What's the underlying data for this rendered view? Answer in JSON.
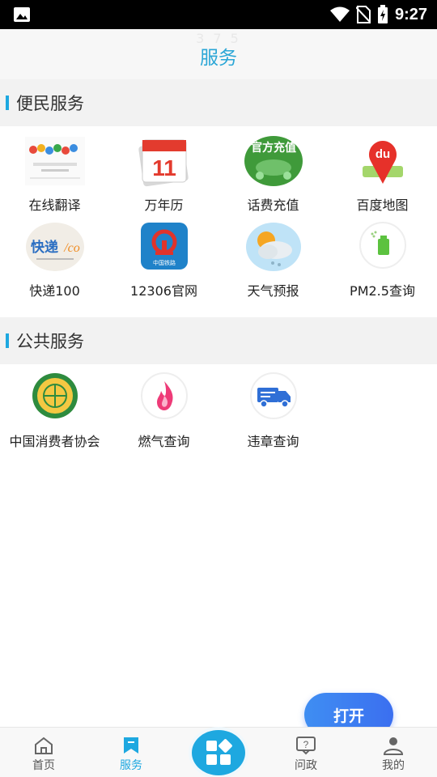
{
  "status_bar": {
    "time": "9:27"
  },
  "header": {
    "ghost_text": "3 7 5",
    "title": "服务"
  },
  "sections": {
    "bianmin": {
      "title": "便民服务",
      "items": [
        {
          "label": "在线翻译",
          "icon": "translate-icon"
        },
        {
          "label": "万年历",
          "icon": "calendar-icon",
          "icon_text": "11"
        },
        {
          "label": "话费充值",
          "icon": "phone-recharge-icon",
          "icon_text": "官方充值"
        },
        {
          "label": "百度地图",
          "icon": "map-pin-icon",
          "icon_text": "du"
        },
        {
          "label": "快递100",
          "icon": "express-icon",
          "icon_text": "快递"
        },
        {
          "label": "12306官网",
          "icon": "railway-icon",
          "icon_text": "中国铁路"
        },
        {
          "label": "天气预报",
          "icon": "weather-icon"
        },
        {
          "label": "PM2.5查询",
          "icon": "air-quality-icon"
        }
      ]
    },
    "gonggong": {
      "title": "公共服务",
      "items": [
        {
          "label": "中国消费者协会",
          "icon": "consumer-association-icon"
        },
        {
          "label": "燃气查询",
          "icon": "flame-icon"
        },
        {
          "label": "违章查询",
          "icon": "truck-icon"
        }
      ]
    }
  },
  "floating": {
    "open_label": "打开"
  },
  "tabbar": [
    {
      "label": "首页",
      "icon": "home-icon"
    },
    {
      "label": "服务",
      "icon": "bookmark-icon",
      "active": true
    },
    {
      "label": "",
      "icon": "grid-icon"
    },
    {
      "label": "问政",
      "icon": "question-icon"
    },
    {
      "label": "我的",
      "icon": "user-icon"
    }
  ],
  "colors": {
    "accent": "#1ea8e0",
    "button": "#3f7ff1"
  }
}
